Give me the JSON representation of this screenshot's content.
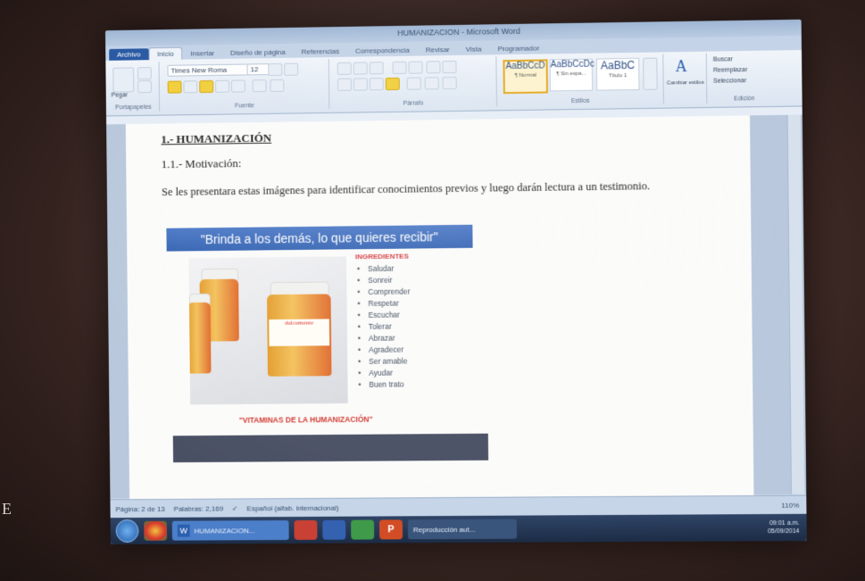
{
  "window": {
    "title": "HUMANIZACION - Microsoft Word"
  },
  "tabs": [
    {
      "label": "Archivo"
    },
    {
      "label": "Inicio"
    },
    {
      "label": "Insertar"
    },
    {
      "label": "Diseño de página"
    },
    {
      "label": "Referencias"
    },
    {
      "label": "Correspondencia"
    },
    {
      "label": "Revisar"
    },
    {
      "label": "Vista"
    },
    {
      "label": "Programador"
    }
  ],
  "ribbon": {
    "font_name": "Times New Roma",
    "font_size": "12",
    "paste_label": "Pegar",
    "groups": {
      "portapapeles": "Portapapeles",
      "fuente": "Fuente",
      "parrafo": "Párrafo",
      "estilos": "Estilos",
      "edicion": "Edición"
    },
    "styles": [
      {
        "preview": "AaBbCcD",
        "name": "¶ Normal"
      },
      {
        "preview": "AaBbCcDc",
        "name": "¶ Sin espa..."
      },
      {
        "preview": "AaBbC",
        "name": "Título 1"
      }
    ],
    "change_styles": "Cambiar estilos",
    "find": "Buscar",
    "replace": "Reemplazar",
    "select": "Seleccionar"
  },
  "document": {
    "heading": "1.- HUMANIZACIÓN",
    "subheading": "1.1.- Motivación:",
    "paragraph": "Se les presentara estas imágenes para identificar conocimientos previos y luego darán lectura a un testimonio.",
    "banner": "\"Brinda a los demás, lo que quieres recibir\"",
    "jar_label": "dulcemente",
    "ingredients_title": "INGREDIENTES",
    "ingredients": [
      "Saludar",
      "Sonreir",
      "Comprender",
      "Respetar",
      "Escuchar",
      "Tolerar",
      "Abrazar",
      "Agradecer",
      "Ser amable",
      "Ayudar",
      "Buen trato"
    ],
    "vitaminas": "\"VITAMINAS DE LA HUMANIZACIÓN\""
  },
  "status": {
    "page": "Página: 2 de 13",
    "words": "Palabras: 2,169",
    "language": "Español (alfab. internacional)",
    "zoom": "110%"
  },
  "taskbar": {
    "word_task": "HUMANIZACION...",
    "media_task": "Reproducción aut...",
    "time": "09:01 a.m.",
    "date": "05/09/2014"
  },
  "edge_letter": "E",
  "colors": {
    "banner": "#3d6cbc",
    "ingredients_title": "#d4373a",
    "taskbar": "#23344f"
  }
}
